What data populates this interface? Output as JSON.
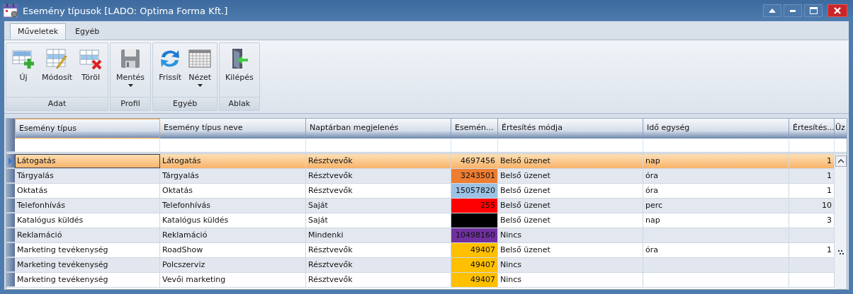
{
  "window": {
    "title": "Esemény típusok [LADO: Optima Forma Kft.]"
  },
  "ribbon_tabs": [
    {
      "label": "Műveletek",
      "selected": true
    },
    {
      "label": "Egyéb",
      "selected": false
    }
  ],
  "ribbon_groups": [
    {
      "label": "Adat",
      "buttons": [
        {
          "label": "Új",
          "dropdown": false
        },
        {
          "label": "Módosít",
          "dropdown": false
        },
        {
          "label": "Töröl",
          "dropdown": false
        }
      ]
    },
    {
      "label": "Profil",
      "buttons": [
        {
          "label": "Mentés",
          "dropdown": true
        }
      ]
    },
    {
      "label": "Egyéb",
      "buttons": [
        {
          "label": "Frissít",
          "dropdown": false
        },
        {
          "label": "Nézet",
          "dropdown": true
        }
      ]
    },
    {
      "label": "Ablak",
      "buttons": [
        {
          "label": "Kilépés",
          "dropdown": false
        }
      ]
    }
  ],
  "table": {
    "columns": [
      "Esemény típus",
      "Esemény típus neve",
      "Naptárban megjelenés",
      "Esemén...",
      "Értesítés módja",
      "Idő egység",
      "Értesítés...",
      "Üz"
    ],
    "rows": [
      {
        "selected": true,
        "cells": [
          "Látogatás",
          "Látogatás",
          "Résztvevők",
          "4697456",
          "Belső üzenet",
          "nap",
          "1"
        ]
      },
      {
        "selected": false,
        "color": "#ed7d31",
        "cells": [
          "Tárgyalás",
          "Tárgyalás",
          "Résztvevők",
          "3243501",
          "Belső üzenet",
          "óra",
          "1"
        ]
      },
      {
        "selected": false,
        "color": "#9cc2e5",
        "cells": [
          "Oktatás",
          "Oktatás",
          "Résztvevők",
          "15057820",
          "Belső üzenet",
          "óra",
          "1"
        ]
      },
      {
        "selected": false,
        "color": "#ff0000",
        "cells": [
          "Telefonhívás",
          "Telefonhívás",
          "Saját",
          "255",
          "Belső üzenet",
          "perc",
          "10"
        ]
      },
      {
        "selected": false,
        "color": "#000000",
        "cells": [
          "Katalógus küldés",
          "Katalógus küldés",
          "Saját",
          "",
          "Belső üzenet",
          "nap",
          "3"
        ]
      },
      {
        "selected": false,
        "color": "#7030a0",
        "cells": [
          "Reklamáció",
          "Reklamáció",
          "Mindenki",
          "10498160",
          "Nincs",
          "",
          ""
        ]
      },
      {
        "selected": false,
        "color": "#ffc000",
        "cells": [
          "Marketing tevékenység",
          "RoadShow",
          "Résztvevők",
          "49407",
          "Belső üzenet",
          "óra",
          "1"
        ]
      },
      {
        "selected": false,
        "color": "#ffc000",
        "cells": [
          "Marketing tevékenység",
          "Polcszerviz",
          "Résztvevők",
          "49407",
          "Nincs",
          "",
          ""
        ]
      },
      {
        "selected": false,
        "color": "#ffc000",
        "cells": [
          "Marketing tevékenység",
          "Vevői marketing",
          "Résztvevők",
          "49407",
          "Nincs",
          "",
          ""
        ]
      }
    ]
  }
}
